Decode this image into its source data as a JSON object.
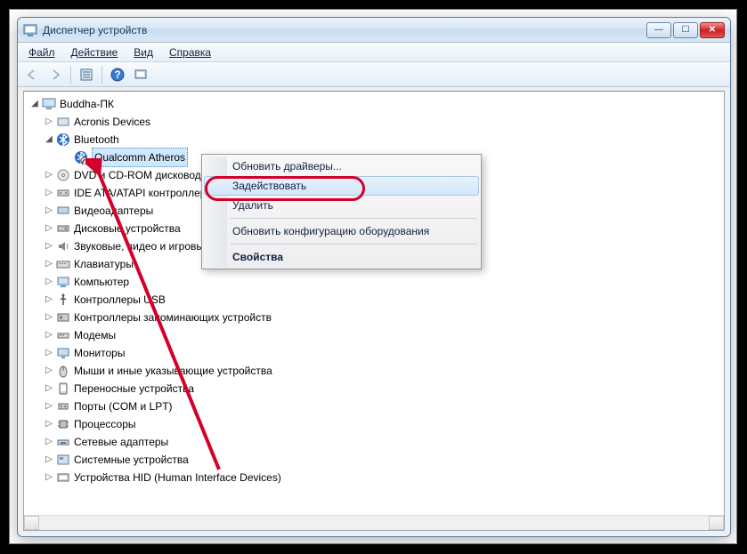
{
  "window": {
    "title": "Диспетчер устройств",
    "min": "—",
    "max": "☐",
    "close": "✕"
  },
  "menu": {
    "file": "Файл",
    "action": "Действие",
    "view": "Вид",
    "help": "Справка"
  },
  "tree": {
    "root": "Buddha-ПК",
    "items": [
      "Acronis Devices",
      "Bluetooth",
      "DVD и CD-ROM дисководы",
      "IDE ATA/ATAPI контроллеры",
      "Видеоадаптеры",
      "Дисковые устройства",
      "Звуковые, видео и игровые устройства",
      "Клавиатуры",
      "Компьютер",
      "Контроллеры USB",
      "Контроллеры запоминающих устройств",
      "Модемы",
      "Мониторы",
      "Мыши и иные указывающие устройства",
      "Переносные устройства",
      "Порты (COM и LPT)",
      "Процессоры",
      "Сетевые адаптеры",
      "Системные устройства",
      "Устройства HID (Human Interface Devices)"
    ],
    "bluetooth_child": "Qualcomm Atheros"
  },
  "context": {
    "update": "Обновить драйверы...",
    "enable": "Задействовать",
    "delete": "Удалить",
    "scan": "Обновить конфигурацию оборудования",
    "props": "Свойства"
  }
}
